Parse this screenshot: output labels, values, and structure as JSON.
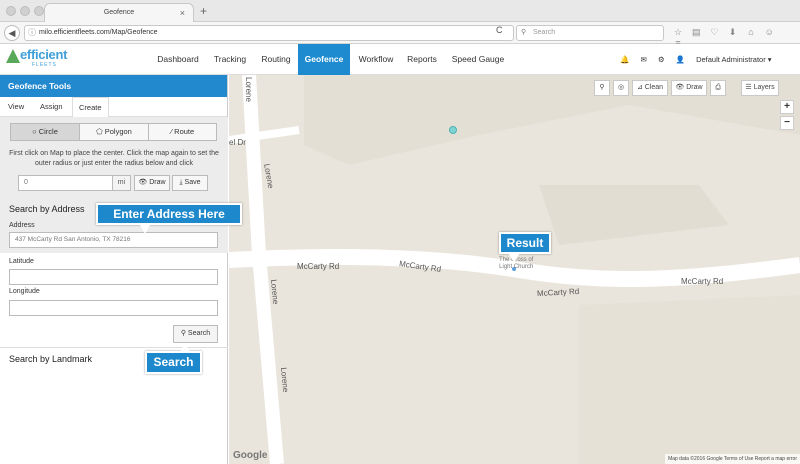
{
  "browser": {
    "tab_title": "Geofence",
    "tab_close": "×",
    "new_tab": "+",
    "url": "milo.efficientfleets.com/Map/Geofence",
    "search_placeholder": "Search",
    "back_glyph": "◀",
    "info_glyph": "ⓘ",
    "reload_glyph": "C",
    "search_glyph": "⚲",
    "icons": [
      "☆",
      "▤",
      "♡",
      "⬇",
      "⌂",
      "☺",
      "≡"
    ]
  },
  "app": {
    "logo_word": "efficient",
    "logo_sub": "FLEETS",
    "nav": [
      "Dashboard",
      "Tracking",
      "Routing",
      "Geofence",
      "Workflow",
      "Reports",
      "Speed Gauge"
    ],
    "active_nav": "Geofence",
    "header_icons": [
      "🔔",
      "✉",
      "⚙"
    ],
    "user": "Default Administrator ▾",
    "user_glyph": "👤"
  },
  "panel": {
    "title": "Geofence Tools",
    "tabs": [
      "View",
      "Assign",
      "Create"
    ],
    "active_tab": "Create",
    "shapes": [
      "Circle",
      "Polygon",
      "Route"
    ],
    "shape_glyphs": [
      "○",
      "⬠",
      "⁄"
    ],
    "instructions": "First click on Map to place the center. Click the map again to set the outer radius or just enter the radius below and click",
    "radius_value": "0",
    "radius_unit": "mi",
    "draw_label": "👁 Draw",
    "save_label": "⤓ Save",
    "search_by_address": "Search by Address",
    "address_label": "Address",
    "address_value": "437 McCarty Rd San Antonio, TX 78216",
    "latitude_label": "Latitude",
    "latitude_value": "",
    "longitude_label": "Longitude",
    "longitude_value": "",
    "search_button": "⚲ Search",
    "search_by_landmark": "Search by Landmark"
  },
  "map": {
    "toolbar": {
      "search_glyph": "⚲",
      "locate_glyph": "◎",
      "clean": "⊿ Clean",
      "draw": "👁 Draw",
      "print_glyph": "⎙",
      "layers": "☰ Layers"
    },
    "zoom_in": "+",
    "zoom_out": "−",
    "road_labels": {
      "mccarty_1": "McCarty Rd",
      "mccarty_2": "McCarty Rd",
      "mccarty_3": "McCarty Rd",
      "mccarty_4": "McCarty Rd",
      "lorene_1": "Lorene",
      "lorene_2": "Lorene",
      "lorene_3": "Lorene",
      "lorene_4": "Lorene",
      "el_dr": "el Dr"
    },
    "church_line1": "The Cross of",
    "church_line2": "Light Church",
    "google": "Google",
    "attribution": "Map data ©2016 Google   Terms of Use   Report a map error"
  },
  "callouts": {
    "enter_address": "Enter Address Here",
    "result": "Result",
    "search": "Search"
  },
  "colors": {
    "primary": "#1e8bd1",
    "map_bg": "#e9e5dc",
    "road": "#ffffff"
  }
}
